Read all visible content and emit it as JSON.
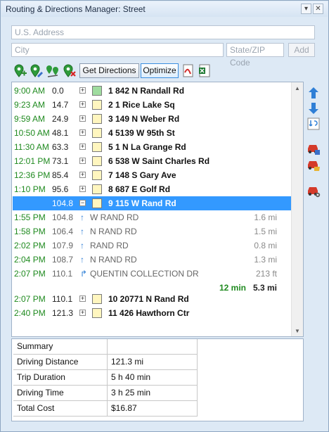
{
  "window": {
    "title": "Routing & Directions Manager: Street"
  },
  "inputs": {
    "address_placeholder": "U.S. Address",
    "city_placeholder": "City",
    "state_zip_placeholder": "State/ZIP Code",
    "add_label": "Add"
  },
  "toolbar": {
    "get_directions_label": "Get Directions",
    "optimize_label": "Optimize"
  },
  "stops_before": [
    {
      "time": "9:00 AM",
      "miles": "0.0",
      "name": "1 842 N Randall Rd",
      "color": "green"
    },
    {
      "time": "9:23 AM",
      "miles": "14.7",
      "name": "2 1 Rice Lake Sq",
      "color": "yellow"
    },
    {
      "time": "9:59 AM",
      "miles": "24.9",
      "name": "3 149 N Weber Rd",
      "color": "yellow"
    },
    {
      "time": "10:50 AM",
      "miles": "48.1",
      "name": "4 5139 W 95th St",
      "color": "yellow"
    },
    {
      "time": "11:30 AM",
      "miles": "63.3",
      "name": "5 1 N La Grange Rd",
      "color": "yellow"
    },
    {
      "time": "12:01 PM",
      "miles": "73.1",
      "name": "6 538 W Saint Charles Rd",
      "color": "yellow"
    },
    {
      "time": "12:36 PM",
      "miles": "85.4",
      "name": "7 148 S Gary Ave",
      "color": "yellow"
    },
    {
      "time": "1:10 PM",
      "miles": "95.6",
      "name": "8 687 E Golf Rd",
      "color": "yellow"
    }
  ],
  "selected_stop": {
    "time": "",
    "miles": "104.8",
    "name": "9 115 W Rand Rd"
  },
  "directions": [
    {
      "time": "1:55 PM",
      "miles": "104.8",
      "arrow": "↑",
      "text": "W RAND RD",
      "dist": "1.6 mi"
    },
    {
      "time": "1:58 PM",
      "miles": "106.4",
      "arrow": "↑",
      "text": "N RAND RD",
      "dist": "1.5 mi"
    },
    {
      "time": "2:02 PM",
      "miles": "107.9",
      "arrow": "↑",
      "text": "RAND RD",
      "dist": "0.8 mi"
    },
    {
      "time": "2:04 PM",
      "miles": "108.7",
      "arrow": "↑",
      "text": "N RAND RD",
      "dist": "1.3 mi"
    },
    {
      "time": "2:07 PM",
      "miles": "110.1",
      "arrow": "↱",
      "text": "QUENTIN COLLECTION DR",
      "dist": "213 ft"
    }
  ],
  "leg_totals": {
    "time": "12 min",
    "distance": "5.3 mi"
  },
  "stops_after": [
    {
      "time": "2:07 PM",
      "miles": "110.1",
      "name": "10 20771 N Rand Rd",
      "color": "yellow"
    },
    {
      "time": "2:40 PM",
      "miles": "121.3",
      "name": "11 426 Hawthorn Ctr",
      "color": "yellow"
    }
  ],
  "summary": {
    "header": "Summary",
    "rows": [
      {
        "label": "Driving Distance",
        "value": "121.3 mi"
      },
      {
        "label": "Trip Duration",
        "value": "5 h 40 min"
      },
      {
        "label": "Driving Time",
        "value": "3 h 25 min"
      },
      {
        "label": "Total Cost",
        "value": "$16.87"
      }
    ]
  }
}
